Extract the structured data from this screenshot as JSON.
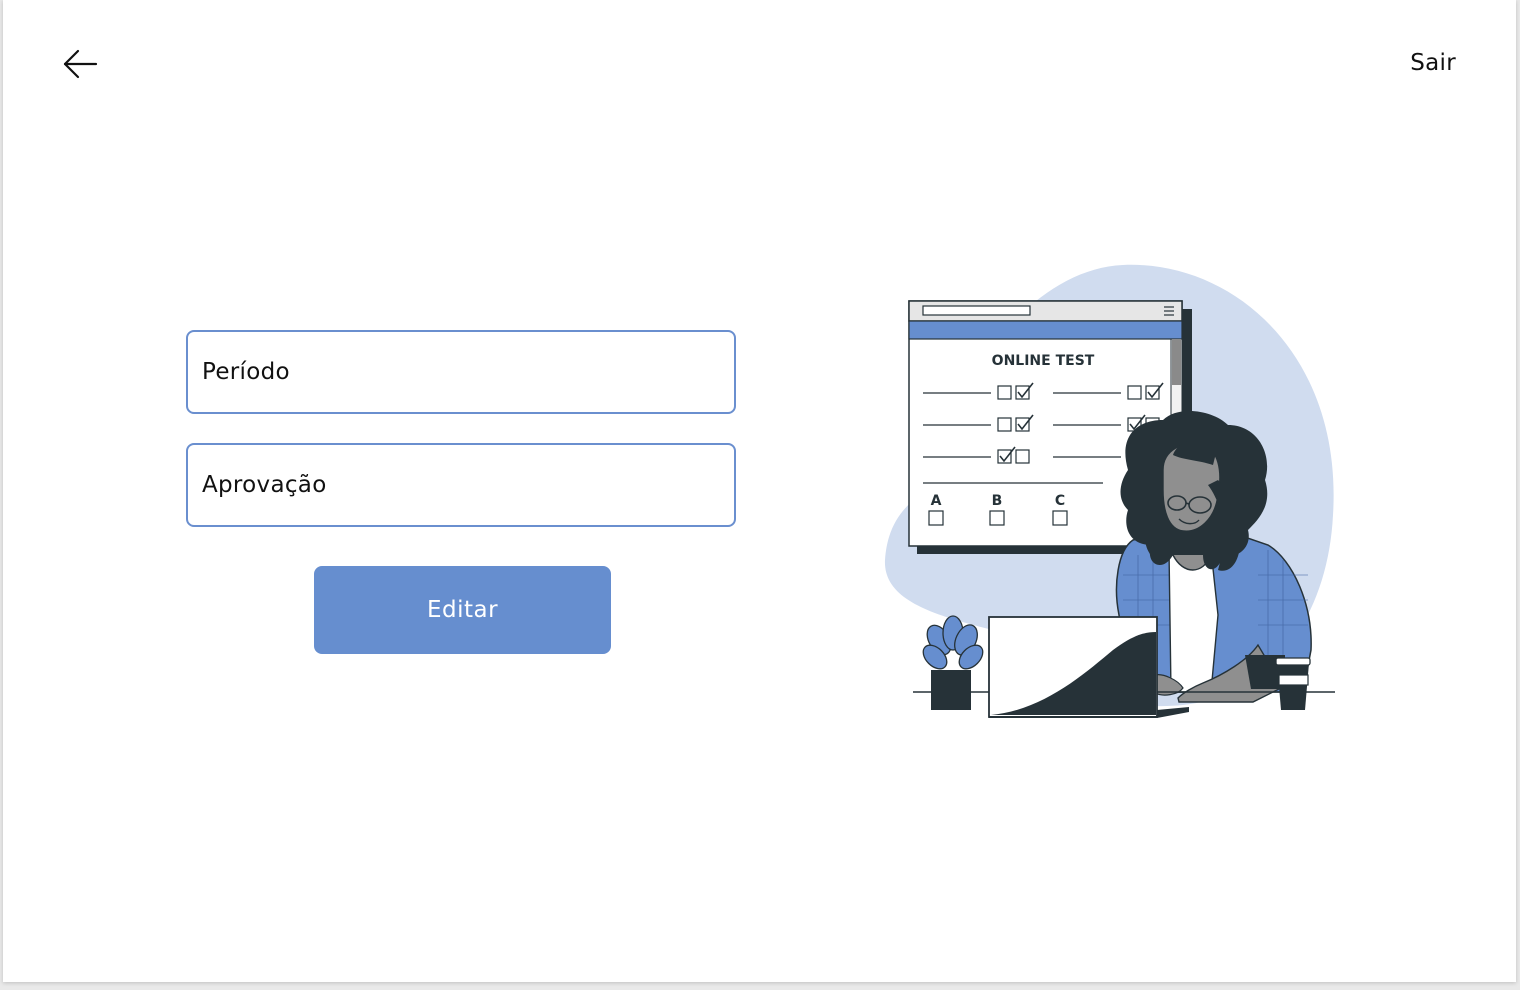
{
  "header": {
    "back_icon": "arrow-left-icon",
    "logout_label": "Sair"
  },
  "form": {
    "periodo_label": "Período",
    "aprovacao_label": "Aprovação",
    "edit_label": "Editar"
  },
  "illustration": {
    "window_title": "ONLINE TEST",
    "option_a": "A",
    "option_b": "B",
    "option_c": "C"
  },
  "colors": {
    "accent": "#668ecf",
    "field_border": "#6a8fcf",
    "blob": "#d0dcef",
    "dark": "#263238"
  }
}
